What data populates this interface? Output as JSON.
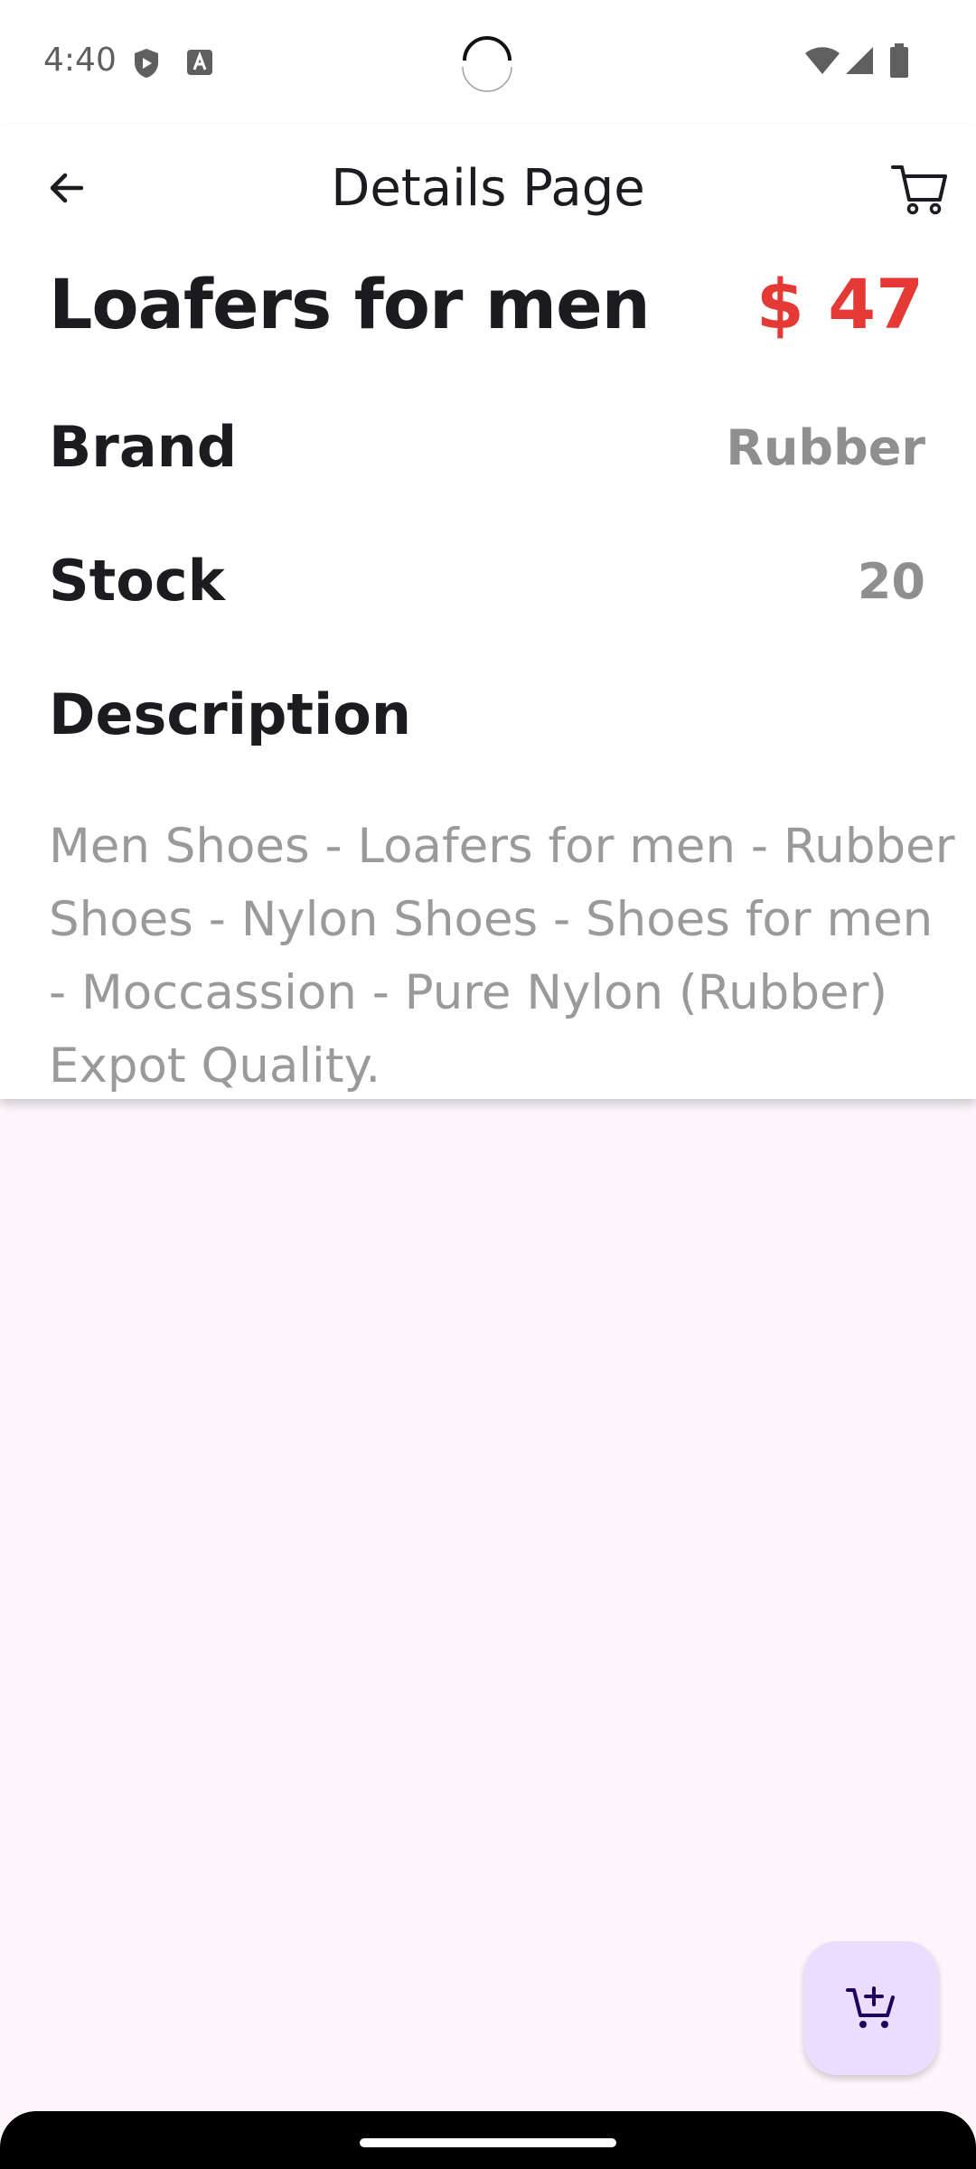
{
  "status_bar": {
    "time": "4:40",
    "icons": [
      "shield-icon",
      "keyboard-a-icon",
      "wifi-icon",
      "signal-icon",
      "battery-icon"
    ]
  },
  "app_bar": {
    "title": "Details Page",
    "back_icon": "arrow-left-icon",
    "cart_icon": "cart-icon"
  },
  "product": {
    "name": "Loafers for men",
    "price": "$ 47",
    "price_color": "#e53935"
  },
  "details": {
    "brand_label": "Brand",
    "brand_value": "Rubber",
    "stock_label": "Stock",
    "stock_value": "20",
    "description_label": "Description",
    "description_text": "Men Shoes - Loafers for men - Rubber Shoes - Nylon Shoes - Shoes for men - Moccassion - Pure Nylon (Rubber) Expot Quality."
  },
  "fab": {
    "icon": "add-shopping-cart-icon",
    "background": "#eaddff"
  }
}
